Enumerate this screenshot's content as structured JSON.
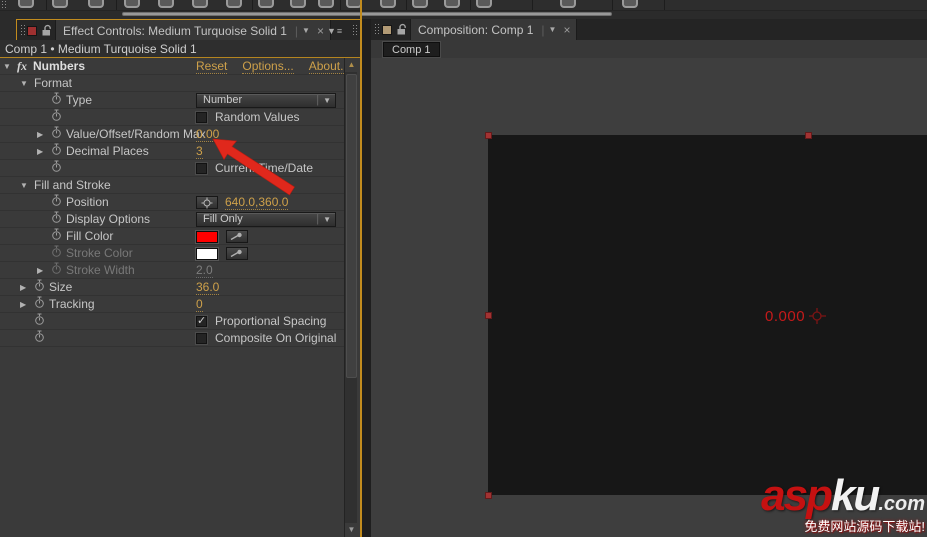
{
  "colors": {
    "accent_gold_border": "#c28c1e",
    "value_gold_text": "#cda04a",
    "fill_swatch": "#ff0000",
    "stroke_swatch": "#ffffff",
    "annotation_arrow_red": "#e0281c",
    "overlay_text_red": "#c41a1a",
    "selection_handle_red": "#a23232",
    "tab_icon_red": "#9e3030",
    "tab_icon_tan": "#b29a75"
  },
  "icons": {
    "stopwatch-icon": "clock outline",
    "lock-icon": "open padlock",
    "grip-icon": "dotted drag grip",
    "tab-dropdown-icon": "▼",
    "close-icon": "×",
    "panel-menu-icon": "▼≡",
    "twirl-open-icon": "▼",
    "twirl-closed-icon": "▶",
    "target-icon": "crosshair circle",
    "eyedropper-icon": "eyedropper",
    "scroll-up-icon": "▲",
    "scroll-down-icon": "▼",
    "anchor-point-icon": "crosshair circle",
    "fx-icon": "fx"
  },
  "effect_controls_panel": {
    "tab": {
      "title": "Effect Controls: Medium Turquoise Solid 1",
      "dropdown": "▼",
      "close": "×"
    },
    "breadcrumb": "Comp 1 • Medium Turquoise Solid 1",
    "effect_header": {
      "fx": "fx",
      "name": "Numbers",
      "links": [
        "Reset",
        "Options...",
        "About..."
      ]
    },
    "rows": [
      {
        "kind": "group",
        "label": "Format",
        "twirl": "open",
        "indent": 0
      },
      {
        "kind": "prop",
        "label": "Type",
        "stopwatch": true,
        "indent": 1,
        "control": {
          "type": "dropdown",
          "value": "Number"
        }
      },
      {
        "kind": "prop",
        "label": "",
        "stopwatch": true,
        "indent": 1,
        "control": {
          "type": "checkbox",
          "checked": false,
          "label": "Random Values"
        }
      },
      {
        "kind": "prop",
        "label": "Value/Offset/Random Max",
        "twirl": "closed",
        "stopwatch": true,
        "indent": 1,
        "control": {
          "type": "value",
          "value": "0.00"
        }
      },
      {
        "kind": "prop",
        "label": "Decimal Places",
        "twirl": "closed",
        "stopwatch": true,
        "indent": 1,
        "control": {
          "type": "value",
          "value": "3"
        }
      },
      {
        "kind": "prop",
        "label": "",
        "stopwatch": true,
        "indent": 1,
        "control": {
          "type": "checkbox",
          "checked": false,
          "label": "Current Time/Date"
        }
      },
      {
        "kind": "group",
        "label": "Fill and Stroke",
        "twirl": "open",
        "indent": 0
      },
      {
        "kind": "prop",
        "label": "Position",
        "stopwatch": true,
        "indent": 1,
        "control": {
          "type": "position",
          "value": "640.0,360.0"
        }
      },
      {
        "kind": "prop",
        "label": "Display Options",
        "stopwatch": true,
        "indent": 1,
        "control": {
          "type": "dropdown",
          "value": "Fill Only"
        }
      },
      {
        "kind": "prop",
        "label": "Fill Color",
        "stopwatch": true,
        "indent": 1,
        "control": {
          "type": "color",
          "swatch": "#ff0000"
        }
      },
      {
        "kind": "prop",
        "label": "Stroke Color",
        "stopwatch": true,
        "indent": 1,
        "disabled": true,
        "control": {
          "type": "color",
          "swatch": "#ffffff"
        }
      },
      {
        "kind": "prop",
        "label": "Stroke Width",
        "twirl": "closed",
        "stopwatch": true,
        "indent": 1,
        "disabled": true,
        "control": {
          "type": "value",
          "value": "2.0"
        }
      },
      {
        "kind": "prop",
        "label": "Size",
        "twirl": "closed",
        "stopwatch": true,
        "indent": 0,
        "control": {
          "type": "value",
          "value": "36.0"
        }
      },
      {
        "kind": "prop",
        "label": "Tracking",
        "twirl": "closed",
        "stopwatch": true,
        "indent": 0,
        "control": {
          "type": "value",
          "value": "0"
        }
      },
      {
        "kind": "prop",
        "label": "",
        "stopwatch": true,
        "indent": 0,
        "control": {
          "type": "checkbox",
          "checked": true,
          "label": "Proportional Spacing"
        }
      },
      {
        "kind": "prop",
        "label": "",
        "stopwatch": true,
        "indent": 0,
        "control": {
          "type": "checkbox",
          "checked": false,
          "label": "Composite On Original"
        }
      }
    ]
  },
  "composition_panel": {
    "tab": {
      "title": "Composition: Comp 1",
      "dropdown": "▼",
      "close": "×"
    },
    "comp_button": "Comp 1",
    "viewer": {
      "overlay_value": "0.000"
    }
  },
  "watermark": {
    "brand_red": "asp",
    "brand_white": "ku",
    "brand_suffix": ".com",
    "tagline": "免费网站源码下载站!"
  }
}
